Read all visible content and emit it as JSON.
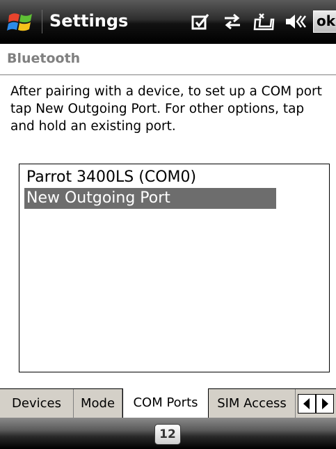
{
  "title_bar": {
    "title": "Settings",
    "icons": [
      "windows-start-icon",
      "checkbox-icon",
      "connectivity-icon",
      "phone-signal-icon",
      "speaker-volume-icon"
    ],
    "ok_label": "ok"
  },
  "header": {
    "title": "Bluetooth"
  },
  "instructions": "After pairing with a device, to set up a COM port tap New Outgoing Port. For other options, tap and hold an existing port.",
  "port_list": {
    "items": [
      {
        "label": "Parrot 3400LS (COM0)",
        "selected": false
      },
      {
        "label": "New Outgoing Port",
        "selected": true
      }
    ]
  },
  "tabs": [
    {
      "label": "Devices",
      "active": false
    },
    {
      "label": "Mode",
      "active": false
    },
    {
      "label": "COM Ports",
      "active": true
    },
    {
      "label": "SIM Access",
      "active": false
    }
  ],
  "tab_scroll": {
    "icons": [
      "arrow-left-icon",
      "arrow-right-icon"
    ]
  },
  "soft_keys": {
    "keyboard_label": "12"
  },
  "colors": {
    "selection": "#6d6d6d",
    "header_text": "#808080",
    "tab_background": "#d4d0c8"
  }
}
